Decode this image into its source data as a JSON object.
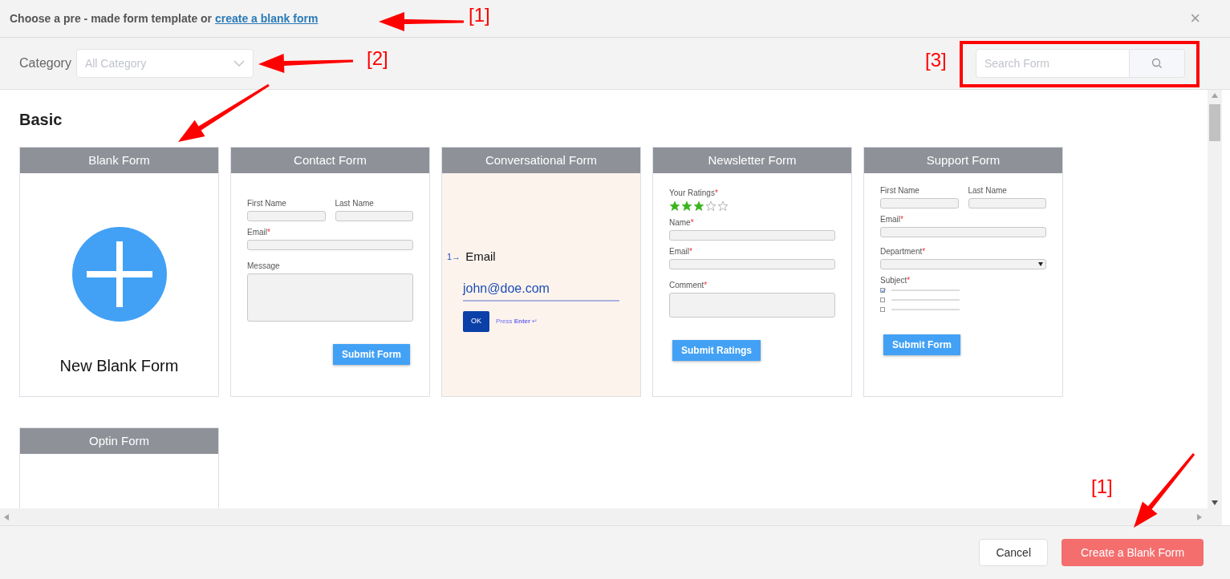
{
  "header": {
    "text": "Choose a pre - made form template or ",
    "link": "create a blank form",
    "close": "×"
  },
  "toolbar": {
    "category_label": "Category",
    "category_placeholder": "All Category",
    "search_placeholder": "Search Form"
  },
  "section": "Basic",
  "templates": [
    {
      "title": "Blank Form",
      "kind": "blank",
      "label": "New Blank Form"
    },
    {
      "title": "Contact Form",
      "kind": "form",
      "button": "Submit Form",
      "fields": [
        {
          "kind": "pair",
          "labels": [
            "First Name",
            "Last Name"
          ]
        },
        {
          "kind": "input",
          "label": "Email",
          "mark": "*"
        },
        {
          "kind": "textarea",
          "label": "Message"
        }
      ]
    },
    {
      "title": "Conversational Form",
      "kind": "conversational",
      "number": "1→",
      "question": "Email",
      "value": "john@doe.com",
      "ok": "OK",
      "hint": "Press **Enter** ↵"
    },
    {
      "title": "Newsletter Form",
      "kind": "form",
      "button": "Submit Ratings",
      "fields": [
        {
          "kind": "rating",
          "label": "Your Ratings",
          "mark": "*",
          "stars": 3
        },
        {
          "kind": "input",
          "label": "Name",
          "mark": "*"
        },
        {
          "kind": "input",
          "label": "Email",
          "mark": "*"
        },
        {
          "kind": "textarea",
          "label": "Comment",
          "mark": "*"
        }
      ]
    },
    {
      "title": "Support Form",
      "kind": "form",
      "button": "Submit Form",
      "fields": [
        {
          "kind": "pair",
          "labels": [
            "First Name",
            "Last Name"
          ]
        },
        {
          "kind": "input",
          "label": "Email",
          "mark": "*"
        },
        {
          "kind": "select",
          "label": "Department",
          "mark": "*"
        },
        {
          "kind": "checks",
          "label": "Subject",
          "mark": "*",
          "options": [
            {
              "checked": true
            },
            {
              "checked": false
            },
            {
              "checked": false
            }
          ]
        }
      ]
    },
    {
      "title": "Optin Form",
      "kind": "empty"
    }
  ],
  "footer": {
    "buttons": [
      {
        "label": "Cancel",
        "kind": "secondary"
      },
      {
        "label": "Create a Blank Form",
        "kind": "primary"
      }
    ]
  },
  "annotations": [
    {
      "label": "[1]"
    },
    {
      "label": "[2]"
    },
    {
      "label": "[3]"
    },
    {
      "label": "[1]"
    }
  ]
}
